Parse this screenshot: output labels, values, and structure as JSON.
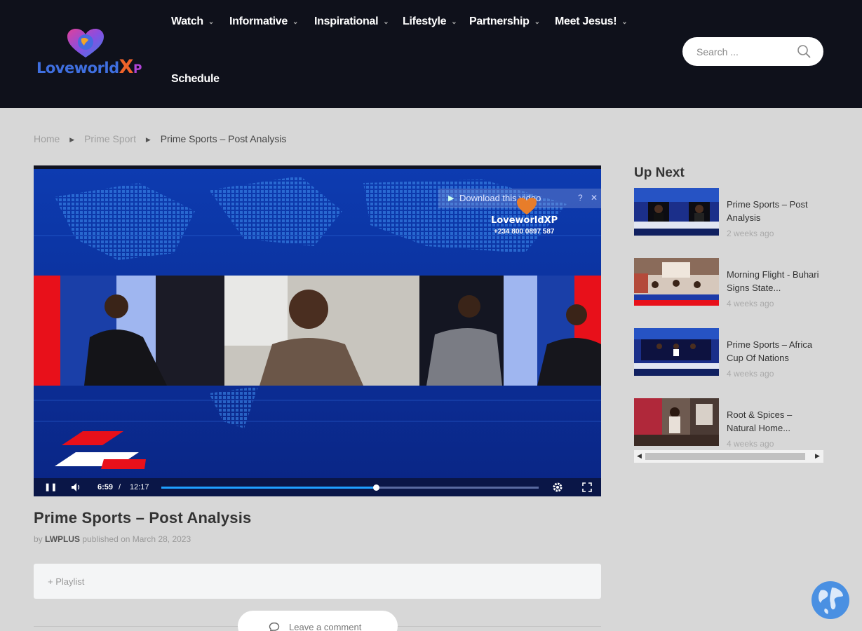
{
  "header": {
    "logo_text": "Loveworld",
    "logo_x": "X",
    "logo_p": "P",
    "nav": [
      {
        "label": "Watch",
        "has_dropdown": true
      },
      {
        "label": "Informative",
        "has_dropdown": true
      },
      {
        "label": "Inspirational",
        "has_dropdown": true
      },
      {
        "label": "Lifestyle",
        "has_dropdown": true
      },
      {
        "label": "Partnership",
        "has_dropdown": true
      },
      {
        "label": "Meet Jesus!",
        "has_dropdown": true
      },
      {
        "label": "Schedule",
        "has_dropdown": false
      }
    ],
    "search_placeholder": "Search ...",
    "search_icon": "search-icon"
  },
  "breadcrumb": {
    "items": [
      "Home",
      "Prime Sport",
      "Prime Sports – Post Analysis"
    ]
  },
  "player": {
    "download_label": "Download this video",
    "watermark_text": "LoveworldXP",
    "watermark_phone": "+234 800 0897 587",
    "current_time": "6:59",
    "separator": "/",
    "duration": "12:17",
    "progress_fraction": 0.569,
    "icons": [
      "pause-icon",
      "volume-icon",
      "settings-gear-icon",
      "fullscreen-icon"
    ]
  },
  "video": {
    "title": "Prime Sports – Post Analysis",
    "by_label": "by",
    "author": "LWPLUS",
    "published": "published on March 28, 2023"
  },
  "playlist_label": "+ Playlist",
  "comment_label": "Leave a comment",
  "up_next": {
    "title": "Up Next",
    "items": [
      {
        "title": "Prime Sports – Post Analysis",
        "date": "2 weeks ago"
      },
      {
        "title": "Morning Flight - Buhari Signs State...",
        "date": "4 weeks ago"
      },
      {
        "title": "Prime Sports – Africa Cup Of Nations",
        "date": "4 weeks ago"
      },
      {
        "title": "Root & Spices – Natural Home...",
        "date": "4 weeks ago"
      }
    ]
  },
  "colors": {
    "header_bg": "#0f111b",
    "page_bg": "#d7d7d7",
    "player_blue": "#0c2a8a",
    "progress_fill": "#1fa0ff"
  }
}
